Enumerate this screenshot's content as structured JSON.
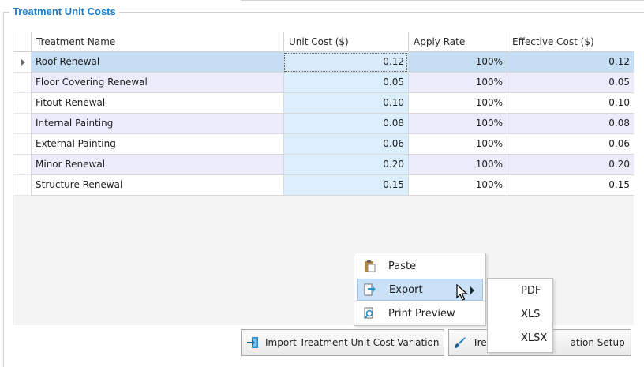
{
  "group": {
    "title": "Treatment Unit Costs"
  },
  "columns": [
    "Treatment Name",
    "Unit Cost ($)",
    "Apply Rate",
    "Effective Cost ($)"
  ],
  "rows": [
    {
      "name": "Roof Renewal",
      "unit_cost": "0.12",
      "apply_rate": "100%",
      "effective_cost": "0.12"
    },
    {
      "name": "Floor Covering Renewal",
      "unit_cost": "0.05",
      "apply_rate": "100%",
      "effective_cost": "0.05"
    },
    {
      "name": "Fitout Renewal",
      "unit_cost": "0.10",
      "apply_rate": "100%",
      "effective_cost": "0.10"
    },
    {
      "name": "Internal Painting",
      "unit_cost": "0.08",
      "apply_rate": "100%",
      "effective_cost": "0.08"
    },
    {
      "name": "External Painting",
      "unit_cost": "0.06",
      "apply_rate": "100%",
      "effective_cost": "0.06"
    },
    {
      "name": "Minor Renewal",
      "unit_cost": "0.20",
      "apply_rate": "100%",
      "effective_cost": "0.20"
    },
    {
      "name": "Structure  Renewal",
      "unit_cost": "0.15",
      "apply_rate": "100%",
      "effective_cost": "0.15"
    }
  ],
  "selected_row": "Roof Renewal",
  "context_menu": {
    "items": [
      {
        "label": "Paste",
        "icon": "clipboard-icon"
      },
      {
        "label": "Export",
        "icon": "export-icon",
        "has_submenu": true
      },
      {
        "label": "Print Preview",
        "icon": "print-preview-icon"
      }
    ],
    "export_submenu": [
      "PDF",
      "XLS",
      "XLSX"
    ]
  },
  "buttons": {
    "import": {
      "label": "Import Treatment Unit Cost Variation",
      "icon": "import-icon"
    },
    "setup": {
      "label_left": "Tre",
      "label_right": "ation Setup",
      "icon": "brush-icon"
    }
  },
  "colors": {
    "title": "#1f7cc4",
    "selected_row": "#c5def3",
    "alt_row": "#ebebfb",
    "unit_cost_column": "#dbeefb",
    "menu_highlight": "#c9e0f7"
  }
}
